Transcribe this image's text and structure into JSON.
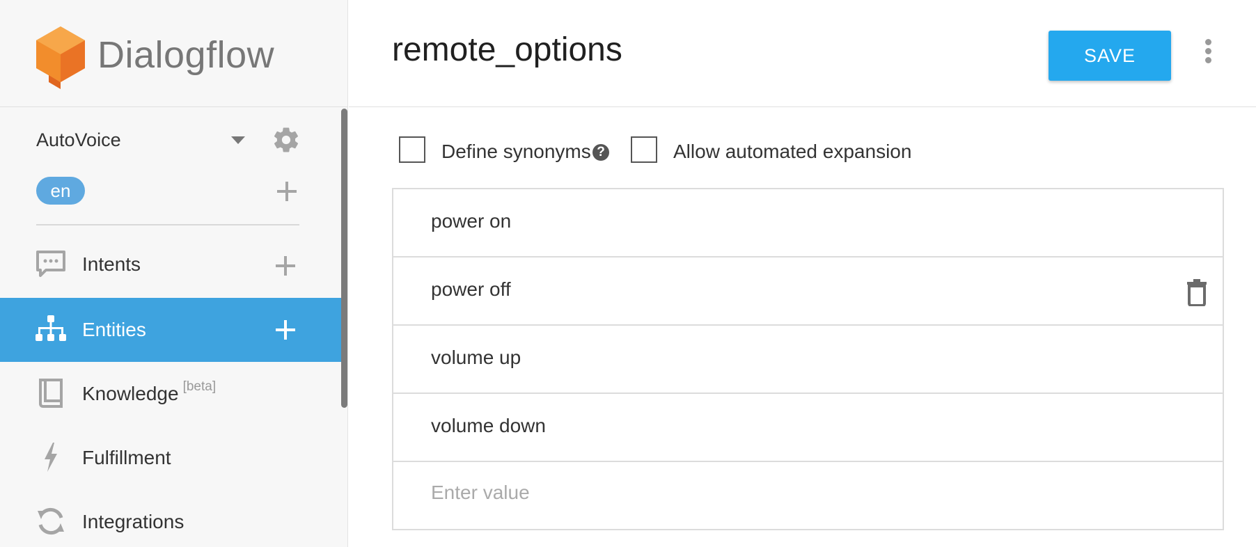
{
  "app": {
    "logo_text": "Dialogflow",
    "brand_colors": {
      "logo_orange": "#f28d2c",
      "accent_blue": "#3ea3df",
      "save_blue": "#24a8ee"
    }
  },
  "sidebar": {
    "agent_name": "AutoVoice",
    "language": "en",
    "nav": [
      {
        "label": "Intents",
        "icon": "chat-bubble-icon",
        "active": false
      },
      {
        "label": "Entities",
        "icon": "hierarchy-icon",
        "active": true
      },
      {
        "label": "Knowledge",
        "badge": "[beta]",
        "icon": "book-icon",
        "active": false
      },
      {
        "label": "Fulfillment",
        "icon": "bolt-icon",
        "active": false
      },
      {
        "label": "Integrations",
        "icon": "refresh-icon",
        "active": false
      }
    ]
  },
  "header": {
    "title": "remote_options",
    "save_label": "SAVE"
  },
  "options": {
    "define_synonyms_label": "Define synonyms",
    "define_synonyms_checked": false,
    "automated_expansion_label": "Allow automated expansion",
    "automated_expansion_checked": false
  },
  "entries": [
    {
      "value": "power on"
    },
    {
      "value": "power off"
    },
    {
      "value": "volume up"
    },
    {
      "value": "volume down"
    }
  ],
  "new_entry": {
    "placeholder": "Enter value",
    "value": ""
  }
}
